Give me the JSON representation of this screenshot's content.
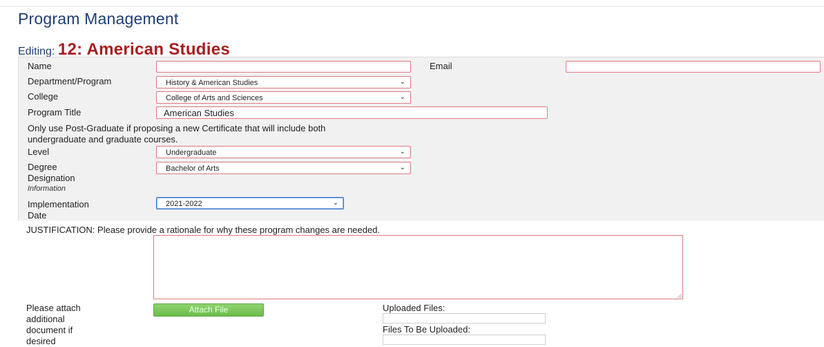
{
  "page": {
    "title": "Program Management"
  },
  "editing": {
    "label": "Editing:",
    "value": "12: American Studies"
  },
  "form": {
    "name": {
      "label": "Name",
      "value": ""
    },
    "email": {
      "label": "Email",
      "value": ""
    },
    "department": {
      "label": "Department/Program",
      "selected": "History & American Studies"
    },
    "college": {
      "label": "College",
      "selected": "College of Arts and Sciences"
    },
    "program_title": {
      "label": "Program Title",
      "value": "American Studies"
    },
    "post_grad_note_line1": "Only use Post-Graduate if proposing a new Certificate that will include both",
    "post_grad_note_line2": "undergraduate and graduate courses.",
    "level": {
      "label": "Level",
      "selected": "Undergraduate"
    },
    "degree": {
      "label_line1": "Degree",
      "label_line2": "Designation",
      "selected": "Bachelor of Arts"
    },
    "information_label": "Information",
    "implementation": {
      "label_line1": "Implementation",
      "label_line2": "Date",
      "selected": "2021-2022"
    },
    "justification": {
      "label": "JUSTIFICATION: Please provide a rationale for why these program changes are needed.",
      "value": ""
    },
    "attach": {
      "label_line1": "Please attach",
      "label_line2": "additional",
      "label_line3": "document if",
      "label_line4": "desired",
      "button": "Attach File"
    },
    "uploaded_label": "Uploaded Files:",
    "to_upload_label": "Files To Be Uploaded:"
  },
  "colors": {
    "title": "#1f3f73",
    "editing_value": "#a61d1d",
    "required_border": "#e0797d",
    "focus_border": "#3b77c9",
    "button_green": "#6cbc4b"
  },
  "icons": {
    "select_arrow": "chevron-down-icon",
    "resize": "resize-grip-icon"
  }
}
